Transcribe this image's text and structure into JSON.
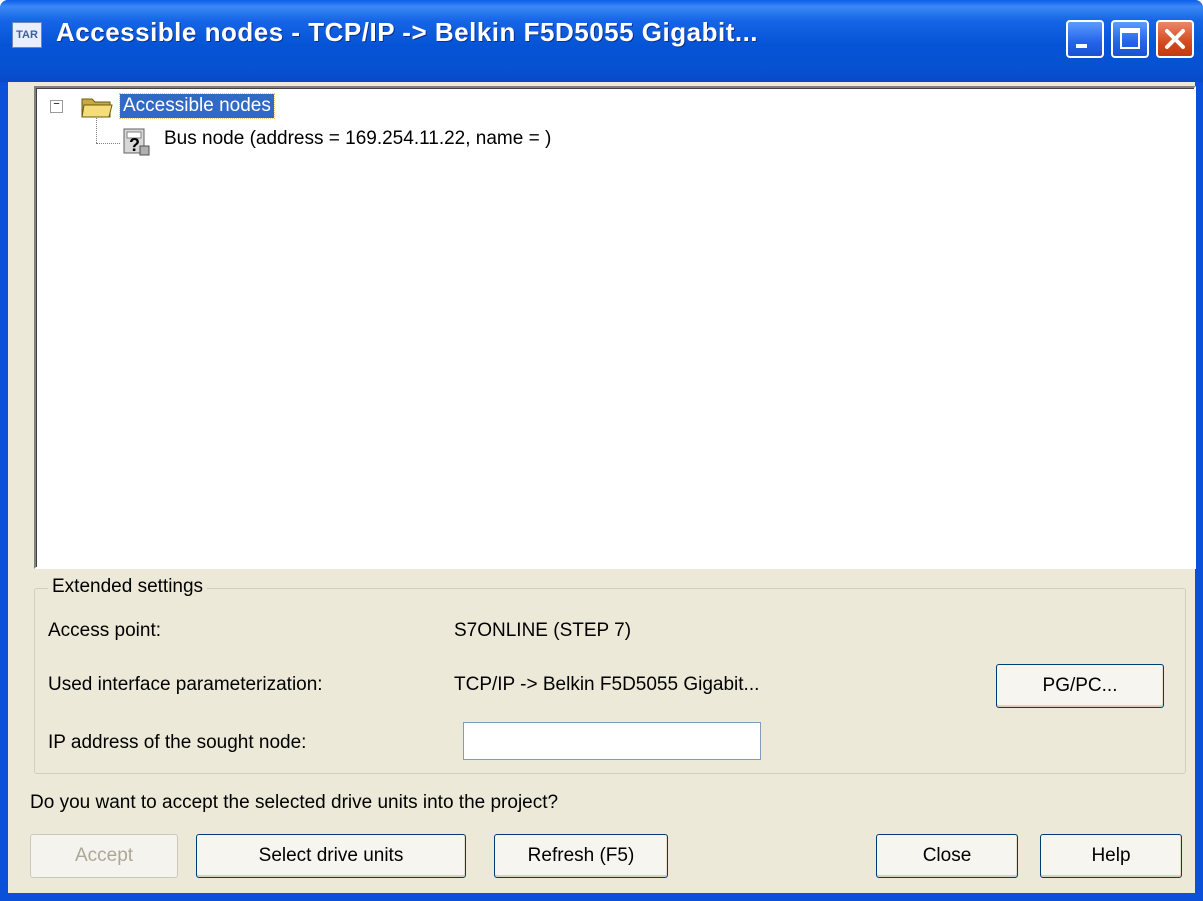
{
  "window": {
    "title": "Accessible nodes - TCP/IP -> Belkin F5D5055 Gigabit...",
    "app_icon_text": "TAR",
    "controls": [
      "minimize-icon",
      "maximize-icon",
      "close-icon"
    ]
  },
  "tree": {
    "root": {
      "label": "Accessible nodes",
      "expanded": true,
      "selected": true,
      "icon": "folder-icon",
      "expander": "−"
    },
    "children": [
      {
        "label": "Bus node (address = 169.254.11.22, name = )",
        "icon": "unknown-node-icon"
      }
    ]
  },
  "extended": {
    "legend": "Extended settings",
    "access_point_label": "Access point:",
    "access_point_value": "S7ONLINE (STEP 7)",
    "interface_label": "Used interface parameterization:",
    "interface_value": "TCP/IP -> Belkin F5D5055 Gigabit...",
    "pgpc_button": "PG/PC...",
    "ip_label": "IP address of the sought node:",
    "ip_value": ""
  },
  "question": "Do you want to accept the selected drive units into the project?",
  "buttons": {
    "accept": "Accept",
    "select": "Select drive units",
    "refresh": "Refresh (F5)",
    "close": "Close",
    "help": "Help"
  },
  "colors": {
    "titlebar": "#0654d6",
    "selection": "#316ac5",
    "dialog_bg": "#ece9d8",
    "close_button": "#d44a1f"
  }
}
